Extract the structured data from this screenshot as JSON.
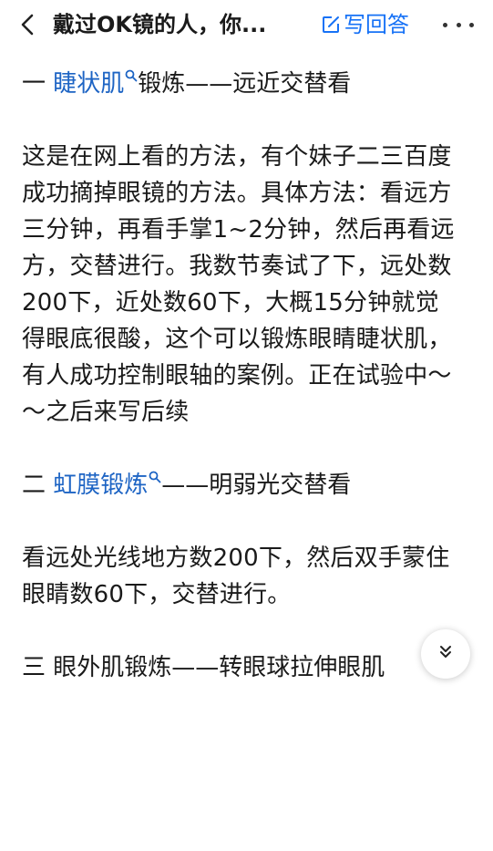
{
  "header": {
    "title": "戴过OK镜的人，你...",
    "write_answer_label": "写回答",
    "icons": {
      "back": "chevron-left-icon",
      "write": "edit-icon",
      "more": "more-icon"
    }
  },
  "article": {
    "sections": [
      {
        "prefix": "一 ",
        "link": "睫状肌",
        "suffix": "锻炼——远近交替看",
        "body": "这是在网上看的方法，有个妹子二三百度成功摘掉眼镜的方法。具体方法：看远方三分钟，再看手掌1~2分钟，然后再看远方，交替进行。我数节奏试了下，远处数200下，近处数60下，大概15分钟就觉得眼底很酸，这个可以锻炼眼睛睫状肌，有人成功控制眼轴的案例。正在试验中～～之后来写后续"
      },
      {
        "prefix": "二 ",
        "link": "虹膜锻炼",
        "suffix": "——明弱光交替看",
        "body": "看远处光线地方数200下，然后双手蒙住眼睛数60下，交替进行。"
      },
      {
        "prefix": "三 眼外肌锻炼——转眼球拉伸眼肌",
        "link": "",
        "suffix": "",
        "body": ""
      }
    ]
  },
  "floating_button": {
    "icon": "double-chevron-down-icon"
  },
  "colors": {
    "link": "#1d64c4",
    "accent": "#1772f6",
    "text": "#1a1a1a"
  }
}
